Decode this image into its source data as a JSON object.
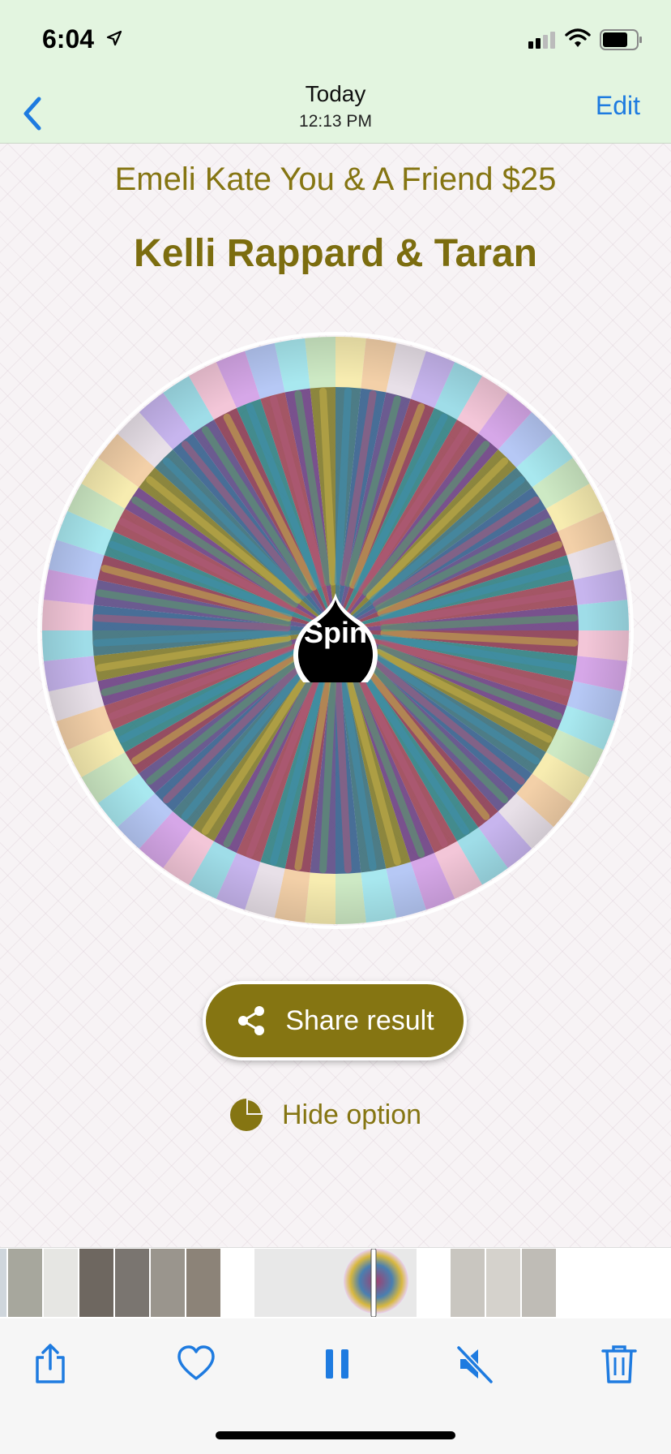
{
  "status": {
    "time": "6:04"
  },
  "nav": {
    "title": "Today",
    "subtitle": "12:13 PM",
    "edit_label": "Edit"
  },
  "wheel": {
    "title": "Emeli Kate You & A Friend $25",
    "result": "Kelli Rappard & Taran",
    "spin_label": "Spin"
  },
  "actions": {
    "share_label": "Share result",
    "hide_label": "Hide option"
  },
  "colors": {
    "accent": "#857512",
    "ios_blue": "#1e7be0",
    "status_bg": "#e3f5e0"
  },
  "toolbar": {
    "icons": [
      "share-icon",
      "heart-icon",
      "pause-icon",
      "mute-icon",
      "trash-icon"
    ]
  }
}
